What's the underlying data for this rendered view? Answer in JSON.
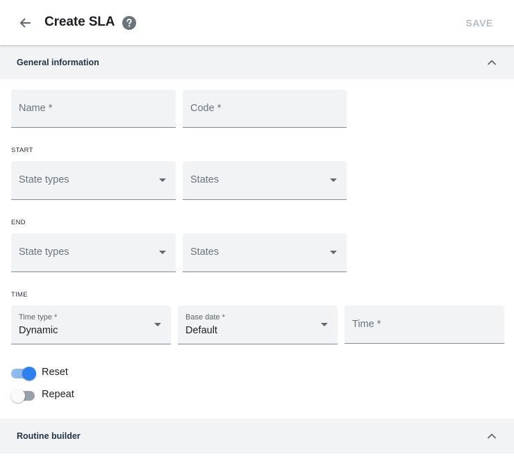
{
  "header": {
    "title": "Create SLA",
    "save_label": "SAVE",
    "back_icon": "arrow-left-icon",
    "help_icon": "question-circle-icon"
  },
  "sections": {
    "general": {
      "label": "General information",
      "expanded": true
    },
    "routine": {
      "label": "Routine builder",
      "expanded": true
    }
  },
  "fields": {
    "name": {
      "placeholder": "Name *"
    },
    "code": {
      "placeholder": "Code *"
    }
  },
  "start": {
    "label": "START",
    "state_types": {
      "placeholder": "State types"
    },
    "states": {
      "placeholder": "States"
    }
  },
  "end": {
    "label": "END",
    "state_types": {
      "placeholder": "State types"
    },
    "states": {
      "placeholder": "States"
    }
  },
  "time": {
    "label": "TIME",
    "time_type": {
      "label": "Time type *",
      "value": "Dynamic"
    },
    "base_date": {
      "label": "Base date *",
      "value": "Default"
    },
    "time": {
      "placeholder": "Time *"
    }
  },
  "toggles": {
    "reset": {
      "label": "Reset",
      "on": true
    },
    "repeat": {
      "label": "Repeat",
      "on": false
    }
  },
  "colors": {
    "accent": "#2f80ed",
    "section_bg": "#f1f3f5",
    "disabled_text": "#b7bcc4"
  }
}
